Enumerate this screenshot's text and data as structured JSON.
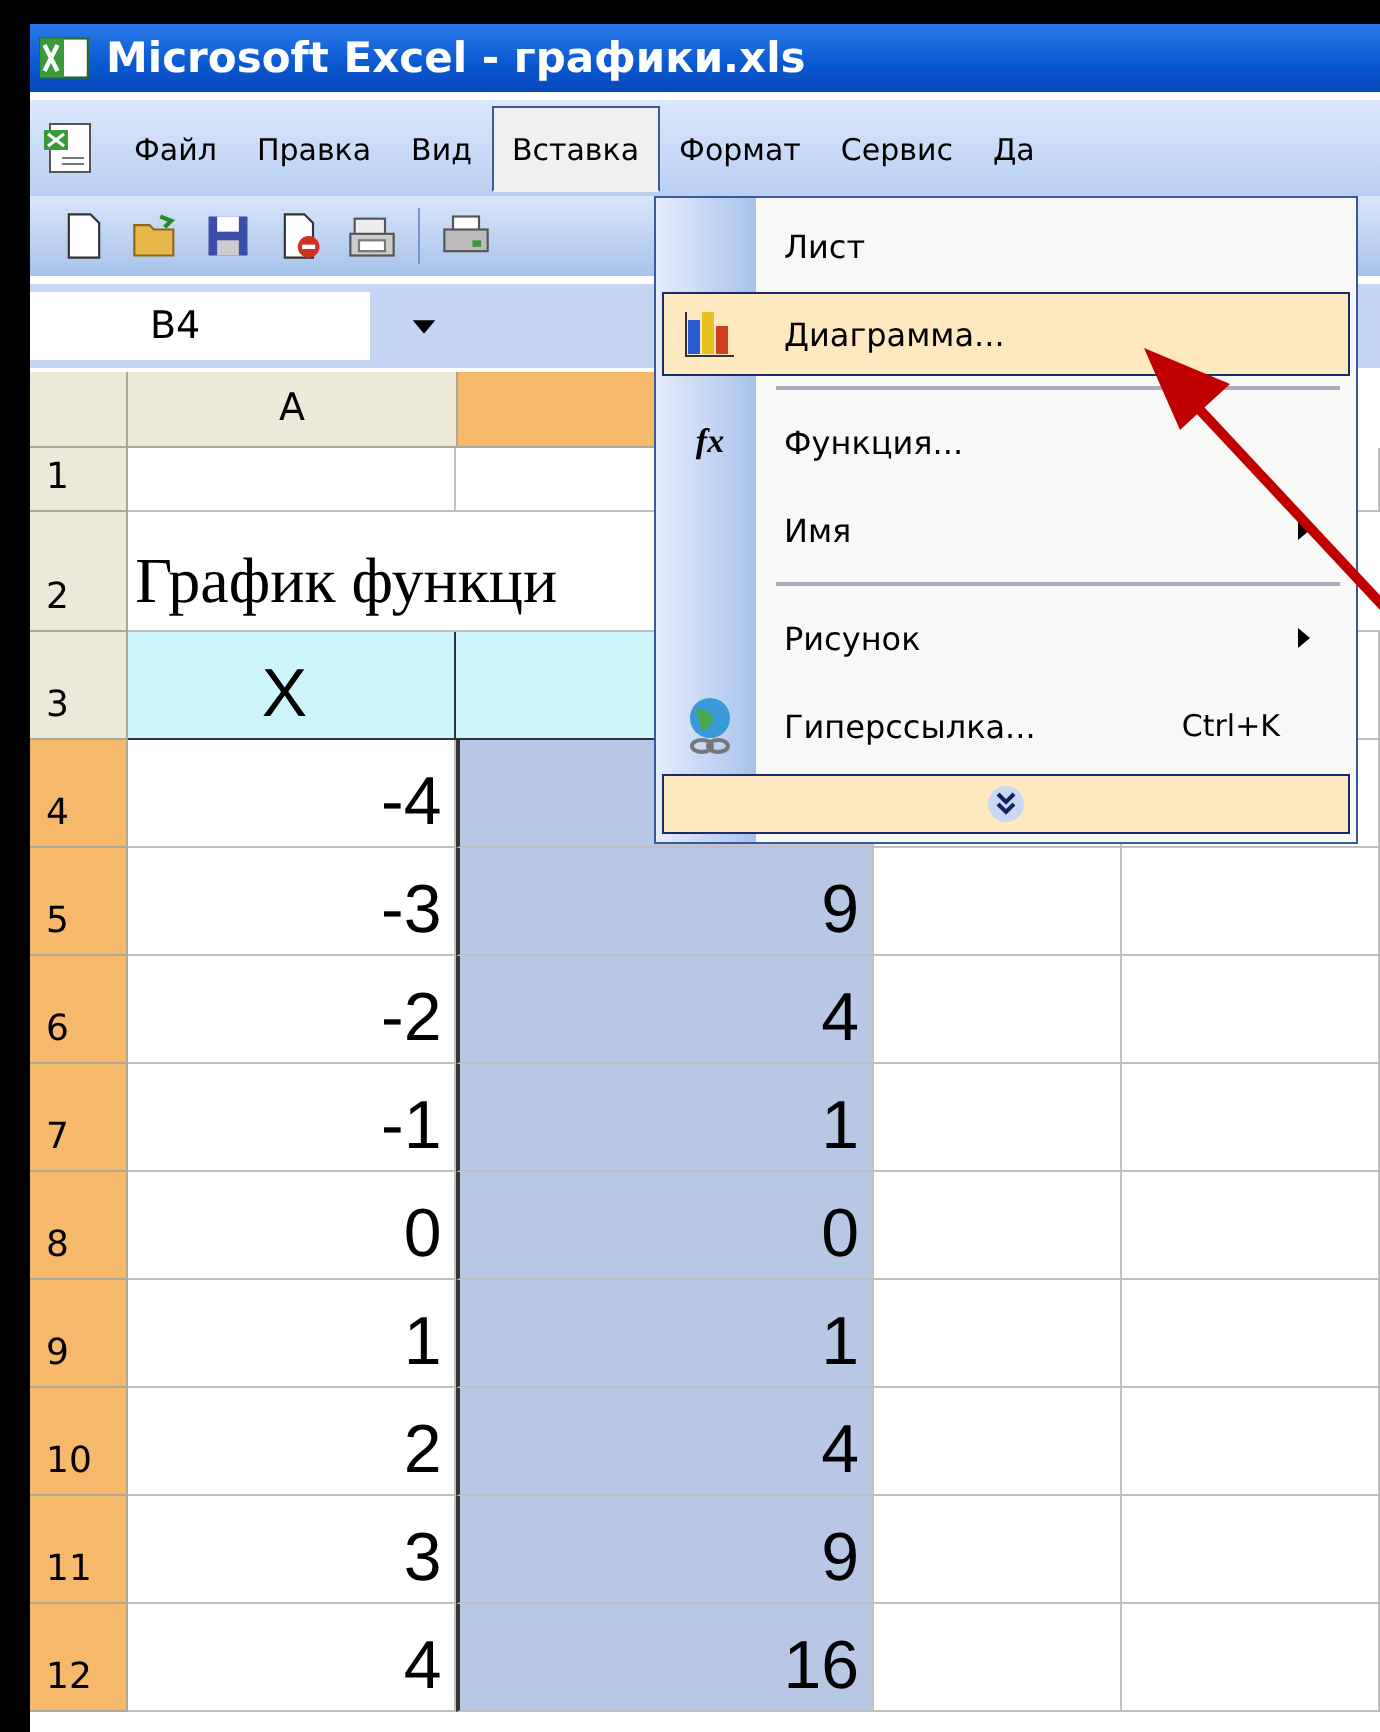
{
  "window": {
    "title": "Microsoft Excel - графики.xls"
  },
  "menu_bar": [
    {
      "label": "Файл",
      "selected": false
    },
    {
      "label": "Правка",
      "selected": false
    },
    {
      "label": "Вид",
      "selected": false
    },
    {
      "label": "Вставка",
      "selected": true
    },
    {
      "label": "Формат",
      "selected": false
    },
    {
      "label": "Сервис",
      "selected": false
    },
    {
      "label": "Да",
      "selected": false
    }
  ],
  "toolbar": [
    {
      "kind": "new"
    },
    {
      "kind": "open"
    },
    {
      "kind": "save"
    },
    {
      "kind": "permission"
    },
    {
      "kind": "mail"
    },
    {
      "kind": "separator"
    },
    {
      "kind": "print"
    }
  ],
  "name_box": {
    "value": "B4"
  },
  "columns": [
    {
      "label": "A",
      "selected": false
    },
    {
      "selected": true
    }
  ],
  "rows": [
    {
      "number": "1",
      "selected": false,
      "cells": [
        "",
        "",
        "",
        ""
      ]
    },
    {
      "number": "2",
      "selected": false,
      "cells": [
        "График функци",
        "",
        "",
        ""
      ],
      "kind": "title"
    },
    {
      "number": "3",
      "selected": false,
      "cells": [
        "X",
        "",
        "",
        ""
      ],
      "kind": "header"
    },
    {
      "number": "4",
      "selected": true,
      "cells": [
        "-4",
        "",
        "",
        ""
      ]
    },
    {
      "number": "5",
      "selected": true,
      "cells": [
        "-3",
        "9",
        "",
        ""
      ]
    },
    {
      "number": "6",
      "selected": true,
      "cells": [
        "-2",
        "4",
        "",
        ""
      ]
    },
    {
      "number": "7",
      "selected": true,
      "cells": [
        "-1",
        "1",
        "",
        ""
      ]
    },
    {
      "number": "8",
      "selected": true,
      "cells": [
        "0",
        "0",
        "",
        ""
      ]
    },
    {
      "number": "9",
      "selected": true,
      "cells": [
        "1",
        "1",
        "",
        ""
      ]
    },
    {
      "number": "10",
      "selected": true,
      "cells": [
        "2",
        "4",
        "",
        ""
      ]
    },
    {
      "number": "11",
      "selected": true,
      "cells": [
        "3",
        "9",
        "",
        ""
      ]
    },
    {
      "number": "12",
      "selected": true,
      "cells": [
        "4",
        "16",
        "",
        ""
      ]
    }
  ],
  "dropdown_menu": [
    {
      "kind": "plain",
      "label": "Лист",
      "selected": false
    },
    {
      "kind": "chart",
      "label": "Диаграмма...",
      "selected": true
    },
    {
      "kind": "separator"
    },
    {
      "kind": "function",
      "label": "Функция...",
      "selected": false,
      "icon_text": "fx"
    },
    {
      "kind": "plain",
      "label": "Имя",
      "selected": false,
      "submenu": true
    },
    {
      "kind": "separator"
    },
    {
      "kind": "plain",
      "label": "Рисунок",
      "selected": false,
      "submenu": true
    },
    {
      "kind": "hyperlink",
      "label": "Гиперссылка...",
      "selected": false,
      "shortcut": "Ctrl+K"
    },
    {
      "kind": "expand"
    }
  ]
}
